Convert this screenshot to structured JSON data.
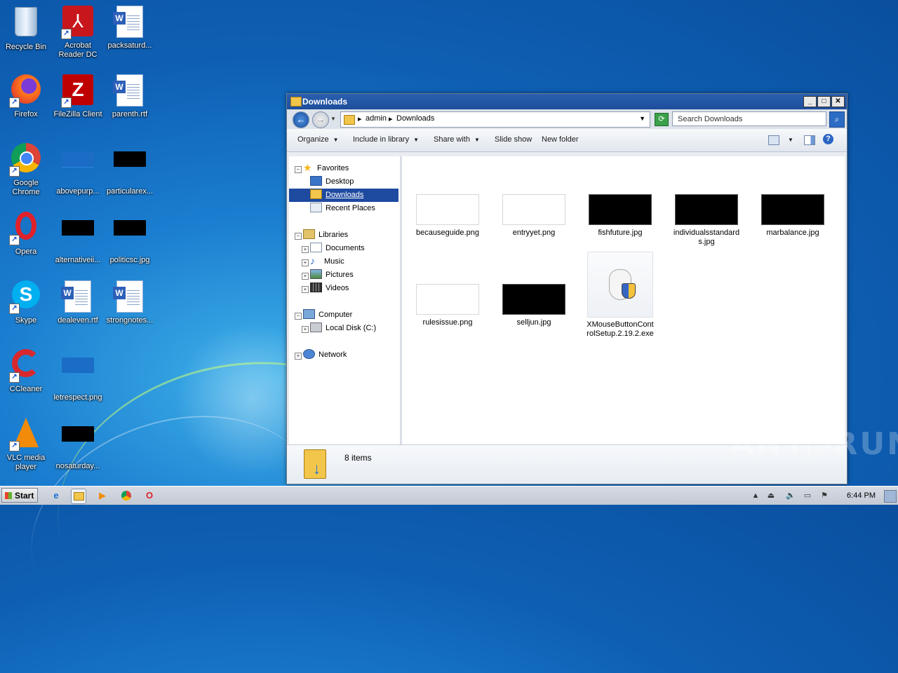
{
  "desktop": {
    "icons": [
      {
        "label": "Recycle Bin"
      },
      {
        "label": "Acrobat Reader DC"
      },
      {
        "label": "packsaturd..."
      },
      {
        "label": "Firefox"
      },
      {
        "label": "FileZilla Client"
      },
      {
        "label": "parenth.rtf"
      },
      {
        "label": "Google Chrome"
      },
      {
        "label": "abovepurp..."
      },
      {
        "label": "particularex..."
      },
      {
        "label": "Opera"
      },
      {
        "label": "alternativeii..."
      },
      {
        "label": "politicsc.jpg"
      },
      {
        "label": "Skype"
      },
      {
        "label": "dealeven.rtf"
      },
      {
        "label": "strongnotes..."
      },
      {
        "label": "CCleaner"
      },
      {
        "label": "letrespect.png"
      },
      {
        "label": "VLC media player"
      },
      {
        "label": "nosaturday..."
      }
    ]
  },
  "window": {
    "title": "Downloads",
    "min_glyph": "_",
    "max_glyph": "□",
    "close_glyph": "✕",
    "breadcrumb": [
      "admin",
      "Downloads"
    ],
    "search_placeholder": "Search Downloads",
    "toolbar": {
      "organize": "Organize",
      "include": "Include in library",
      "share": "Share with",
      "slideshow": "Slide show",
      "newfolder": "New folder"
    },
    "nav": {
      "favorites": "Favorites",
      "desktop": "Desktop",
      "downloads": "Downloads",
      "recent": "Recent Places",
      "libraries": "Libraries",
      "documents": "Documents",
      "music": "Music",
      "pictures": "Pictures",
      "videos": "Videos",
      "computer": "Computer",
      "localdisk": "Local Disk (C:)",
      "network": "Network"
    },
    "files": [
      {
        "name": "becauseguide.png"
      },
      {
        "name": "entryyet.png"
      },
      {
        "name": "fishfuture.jpg"
      },
      {
        "name": "individualsstandards.jpg"
      },
      {
        "name": "marbalance.jpg"
      },
      {
        "name": "rulesissue.png"
      },
      {
        "name": "selljun.jpg"
      },
      {
        "name": "XMouseButtonControlSetup.2.19.2.exe"
      }
    ],
    "status": "8 items"
  },
  "watermark": "ANY▷RUN",
  "taskbar": {
    "start": "Start",
    "clock": "6:44 PM"
  }
}
